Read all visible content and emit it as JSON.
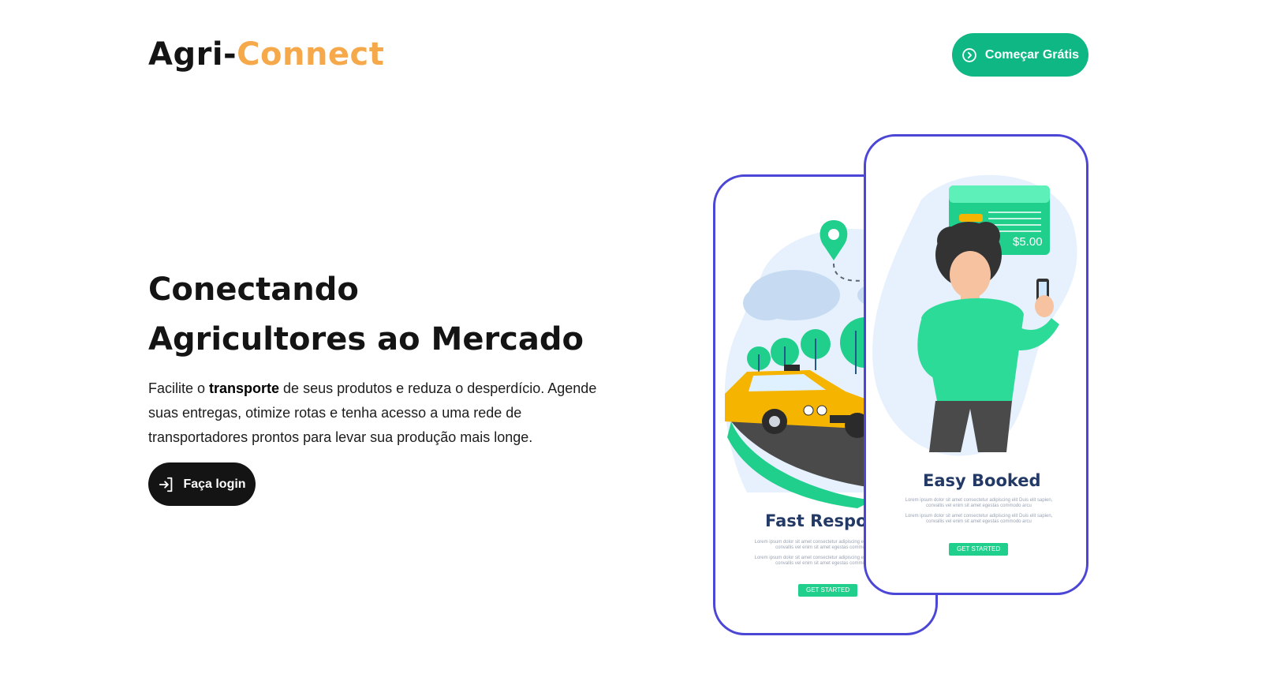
{
  "header": {
    "logo_part1": "Agri-",
    "logo_part2": "Connect",
    "cta_label": "Começar Grátis",
    "cta_icon": "chevron-right-circle-icon"
  },
  "hero": {
    "title_line1": "Conectando",
    "title_line2": "Agricultores ao Mercado",
    "text_before": "Facilite o ",
    "text_bold": "transporte",
    "text_after": " de seus produtos e reduza o desperdício. Agende suas entregas, otimize rotas e tenha acesso a uma rede de transportadores prontos para levar sua produção mais longe.",
    "login_label": "Faça login",
    "login_icon": "login-icon"
  },
  "illustration": {
    "back_phone": {
      "title": "Fast Respor",
      "lorem1": "Lorem ipsum dolor sit amet consectetur adipiscing elit Duis elit sapien, convallis vel enim sit amet egestas commodo arcu",
      "lorem2": "Lorem ipsum dolor sit amet consectetur adipiscing elit Duis elit sapien, convallis vel enim sit amet egestas commodo arcu",
      "button": "GET STARTED"
    },
    "front_phone": {
      "title": "Easy Booked",
      "lorem1": "Lorem ipsum dolor sit amet consectetur adipiscing elit Duis elit sapien, convallis vel enim sit amet egestas commodo arcu",
      "lorem2": "Lorem ipsum dolor sit amet consectetur adipiscing elit Duis elit sapien, convallis vel enim sit amet egestas commodo arcu",
      "button": "GET STARTED",
      "price": "$5.00"
    }
  },
  "colors": {
    "brand_green": "#0fb784",
    "logo_accent": "#f6a94a",
    "phone_border": "#4b46d6",
    "dark": "#141414"
  }
}
